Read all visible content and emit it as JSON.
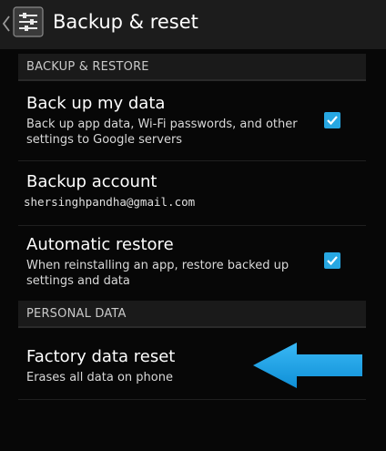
{
  "action_bar": {
    "title": "Backup & reset",
    "back_icon": "chevron-left-icon",
    "app_icon": "settings-sliders-icon"
  },
  "sections": {
    "backup_restore": "BACKUP & RESTORE",
    "personal_data": "PERSONAL DATA"
  },
  "prefs": {
    "backup_data": {
      "title": "Back up my data",
      "summary": "Back up app data, Wi-Fi passwords, and other settings to Google servers",
      "checked": true
    },
    "backup_account": {
      "title": "Backup account",
      "summary": "shersinghpandha@gmail.com"
    },
    "auto_restore": {
      "title": "Automatic restore",
      "summary": "When reinstalling an app, restore backed up settings and data",
      "checked": true
    },
    "factory_reset": {
      "title": "Factory data reset",
      "summary": "Erases all data on phone"
    }
  },
  "colors": {
    "checkbox": "#27a7e2",
    "arrow": "#1aa3ea",
    "background": "#070707"
  }
}
